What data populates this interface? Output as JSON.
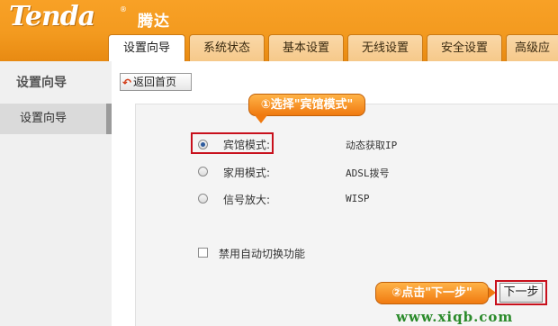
{
  "brand": {
    "logo": "Tenda",
    "registered": "®",
    "name_cn": "腾达"
  },
  "tabs": [
    {
      "label": "设置向导",
      "active": true
    },
    {
      "label": "系统状态",
      "active": false
    },
    {
      "label": "基本设置",
      "active": false
    },
    {
      "label": "无线设置",
      "active": false
    },
    {
      "label": "安全设置",
      "active": false
    },
    {
      "label": "高级应",
      "active": false
    }
  ],
  "sidebar": {
    "title": "设置向导",
    "items": [
      {
        "label": "设置向导"
      }
    ]
  },
  "toolbar": {
    "home_label": "返回首页",
    "home_icon": "return-arrow-icon"
  },
  "modes": [
    {
      "label": "宾馆模式:",
      "type": "动态获取IP",
      "checked": true
    },
    {
      "label": "家用模式:",
      "type": "ADSL拨号",
      "checked": false
    },
    {
      "label": "信号放大:",
      "type": "WISP",
      "checked": false
    }
  ],
  "auto_switch": {
    "label": "禁用自动切换功能",
    "checked": false
  },
  "next_label": "下一步",
  "annotations": {
    "step1": "①选择\"宾馆模式\"",
    "step2": "②点击\"下一步\""
  },
  "watermark": "www.xiqb.com",
  "colors": {
    "header": "#f39a1f",
    "highlight": "#c8101c",
    "callout": "#f07a10",
    "watermark": "#2a8a2a"
  }
}
